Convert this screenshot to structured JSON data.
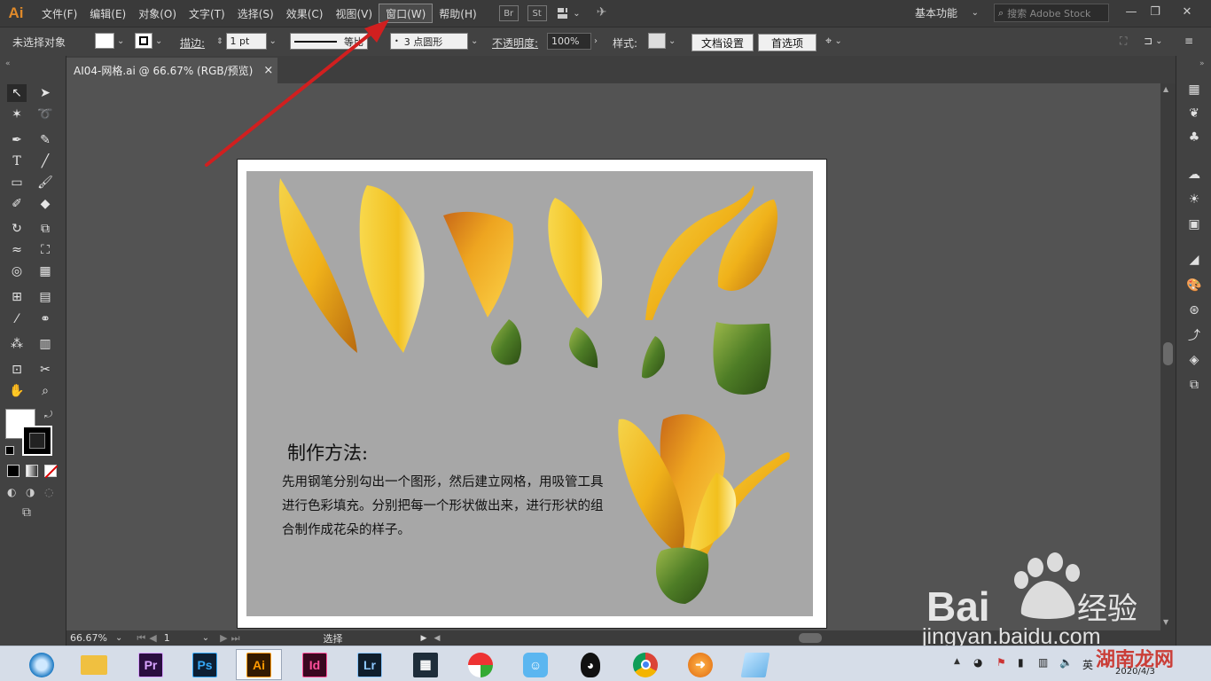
{
  "app": {
    "logo": "Ai"
  },
  "menu": [
    "文件(F)",
    "编辑(E)",
    "对象(O)",
    "文字(T)",
    "选择(S)",
    "效果(C)",
    "视图(V)",
    "窗口(W)",
    "帮助(H)"
  ],
  "app_buttons": [
    "Br",
    "St"
  ],
  "workspace": {
    "label": "基本功能"
  },
  "search": {
    "placeholder": "搜索 Adobe Stock"
  },
  "control": {
    "selection_label": "未选择对象",
    "stroke_label": "描边:",
    "stroke_value": "1 pt",
    "stroke_style": "等比",
    "brush": "3 点圆形",
    "opacity_label": "不透明度:",
    "opacity_value": "100%",
    "style_label": "样式:",
    "doc_setup": "文档设置",
    "preferences": "首选项"
  },
  "document": {
    "tab_title": "AI04-网格.ai @ 66.67% (RGB/预览)",
    "close": "×"
  },
  "artwork": {
    "title": "制作方法:",
    "body": "先用钢笔分别勾出一个图形，然后建立网格，用吸管工具进行色彩填充。分别把每一个形状做出来，进行形状的组合制作成花朵的样子。"
  },
  "status": {
    "zoom": "66.67%",
    "page": "1",
    "tool": "选择"
  },
  "watermark": {
    "brand_text": "Bai du 经验",
    "url": "jingyan.baidu.com",
    "site": "湖南龙网"
  },
  "taskbar": {
    "apps": [
      {
        "name": "Pr",
        "color": "#2a0e3f",
        "fg": "#d9a3ff"
      },
      {
        "name": "Ps",
        "color": "#0d1f33",
        "fg": "#35a7f5"
      },
      {
        "name": "Ai",
        "color": "#331a00",
        "fg": "#ff9a00"
      },
      {
        "name": "Id",
        "color": "#3a0820",
        "fg": "#ff4f9a"
      },
      {
        "name": "Lr",
        "color": "#0f1e2c",
        "fg": "#8ec9ff"
      }
    ],
    "date": "2020/4/3",
    "ime": "英"
  },
  "colors": {
    "accent_arrow": "#d11f1f"
  }
}
